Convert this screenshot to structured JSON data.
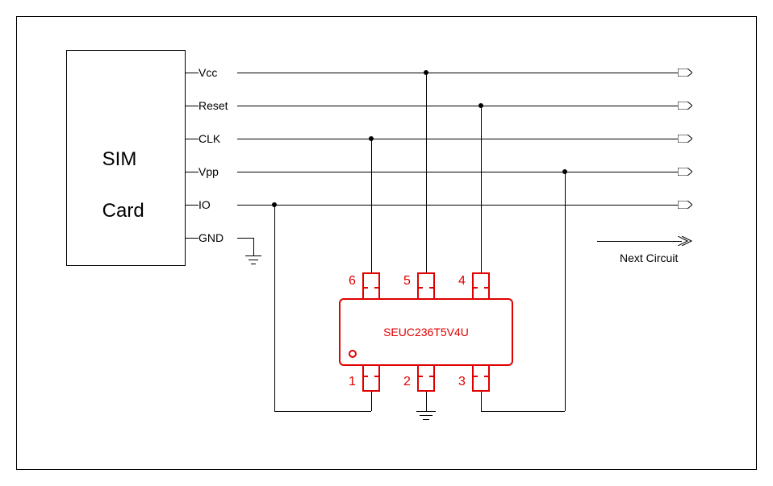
{
  "sim_card": {
    "title_line1": "SIM",
    "title_line2": "Card",
    "pins": {
      "vcc": "Vcc",
      "reset": "Reset",
      "clk": "CLK",
      "vpp": "Vpp",
      "io": "IO",
      "gnd": "GND"
    }
  },
  "ic": {
    "part_number": "SEUC236T5V4U",
    "pins": {
      "p1": "1",
      "p2": "2",
      "p3": "3",
      "p4": "4",
      "p5": "5",
      "p6": "6"
    }
  },
  "arrow_label": "Next Circuit",
  "net_map": {
    "sim_vcc_to_ic_pin": 5,
    "sim_reset_to_ic_pin": 4,
    "sim_clk_to_ic_pin": 6,
    "sim_vpp_to_ic_pin": 3,
    "sim_io_to_ic_pin": 1,
    "sim_gnd_to": "GND",
    "ic_pin2_to": "GND"
  }
}
